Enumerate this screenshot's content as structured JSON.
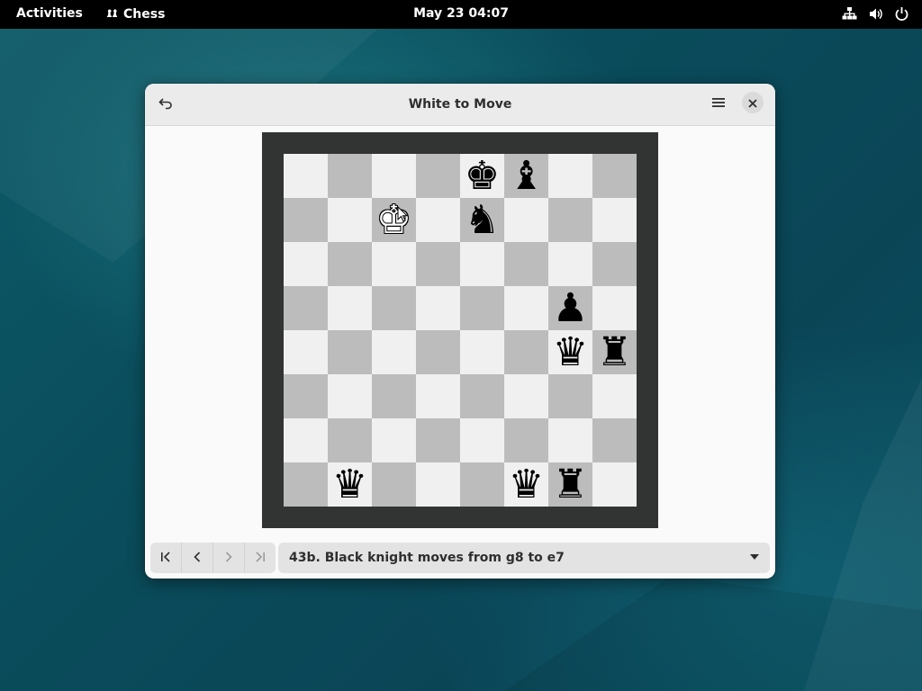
{
  "topbar": {
    "activities": "Activities",
    "app_name": "Chess",
    "clock": "May 23  04:07"
  },
  "window": {
    "title": "White to Move",
    "move_description": "43b. Black knight moves from g8 to e7"
  },
  "board": {
    "light_color": "#f0f0f0",
    "dark_color": "#bcbcbc",
    "frame_color": "#323333",
    "ranks": [
      [
        "",
        "",
        "",
        "",
        "bK",
        "bB",
        "",
        ""
      ],
      [
        "",
        "",
        "wK",
        "",
        "bN",
        "",
        "",
        ""
      ],
      [
        "",
        "",
        "",
        "",
        "",
        "",
        "",
        ""
      ],
      [
        "",
        "",
        "",
        "",
        "",
        "",
        "bP",
        ""
      ],
      [
        "",
        "",
        "",
        "",
        "",
        "",
        "bQ",
        "bR"
      ],
      [
        "",
        "",
        "",
        "",
        "",
        "",
        "",
        ""
      ],
      [
        "",
        "",
        "",
        "",
        "",
        "",
        "",
        ""
      ],
      [
        "",
        "bQ",
        "",
        "",
        "",
        "bQ",
        "bR",
        ""
      ]
    ]
  },
  "icons": {
    "undo": "undo-icon",
    "menu": "hamburger-menu-icon",
    "close": "close-icon",
    "first": "skip-first-icon",
    "prev": "previous-icon",
    "next": "next-icon",
    "last": "skip-last-icon",
    "network": "network-icon",
    "volume": "volume-icon",
    "power": "power-icon"
  }
}
